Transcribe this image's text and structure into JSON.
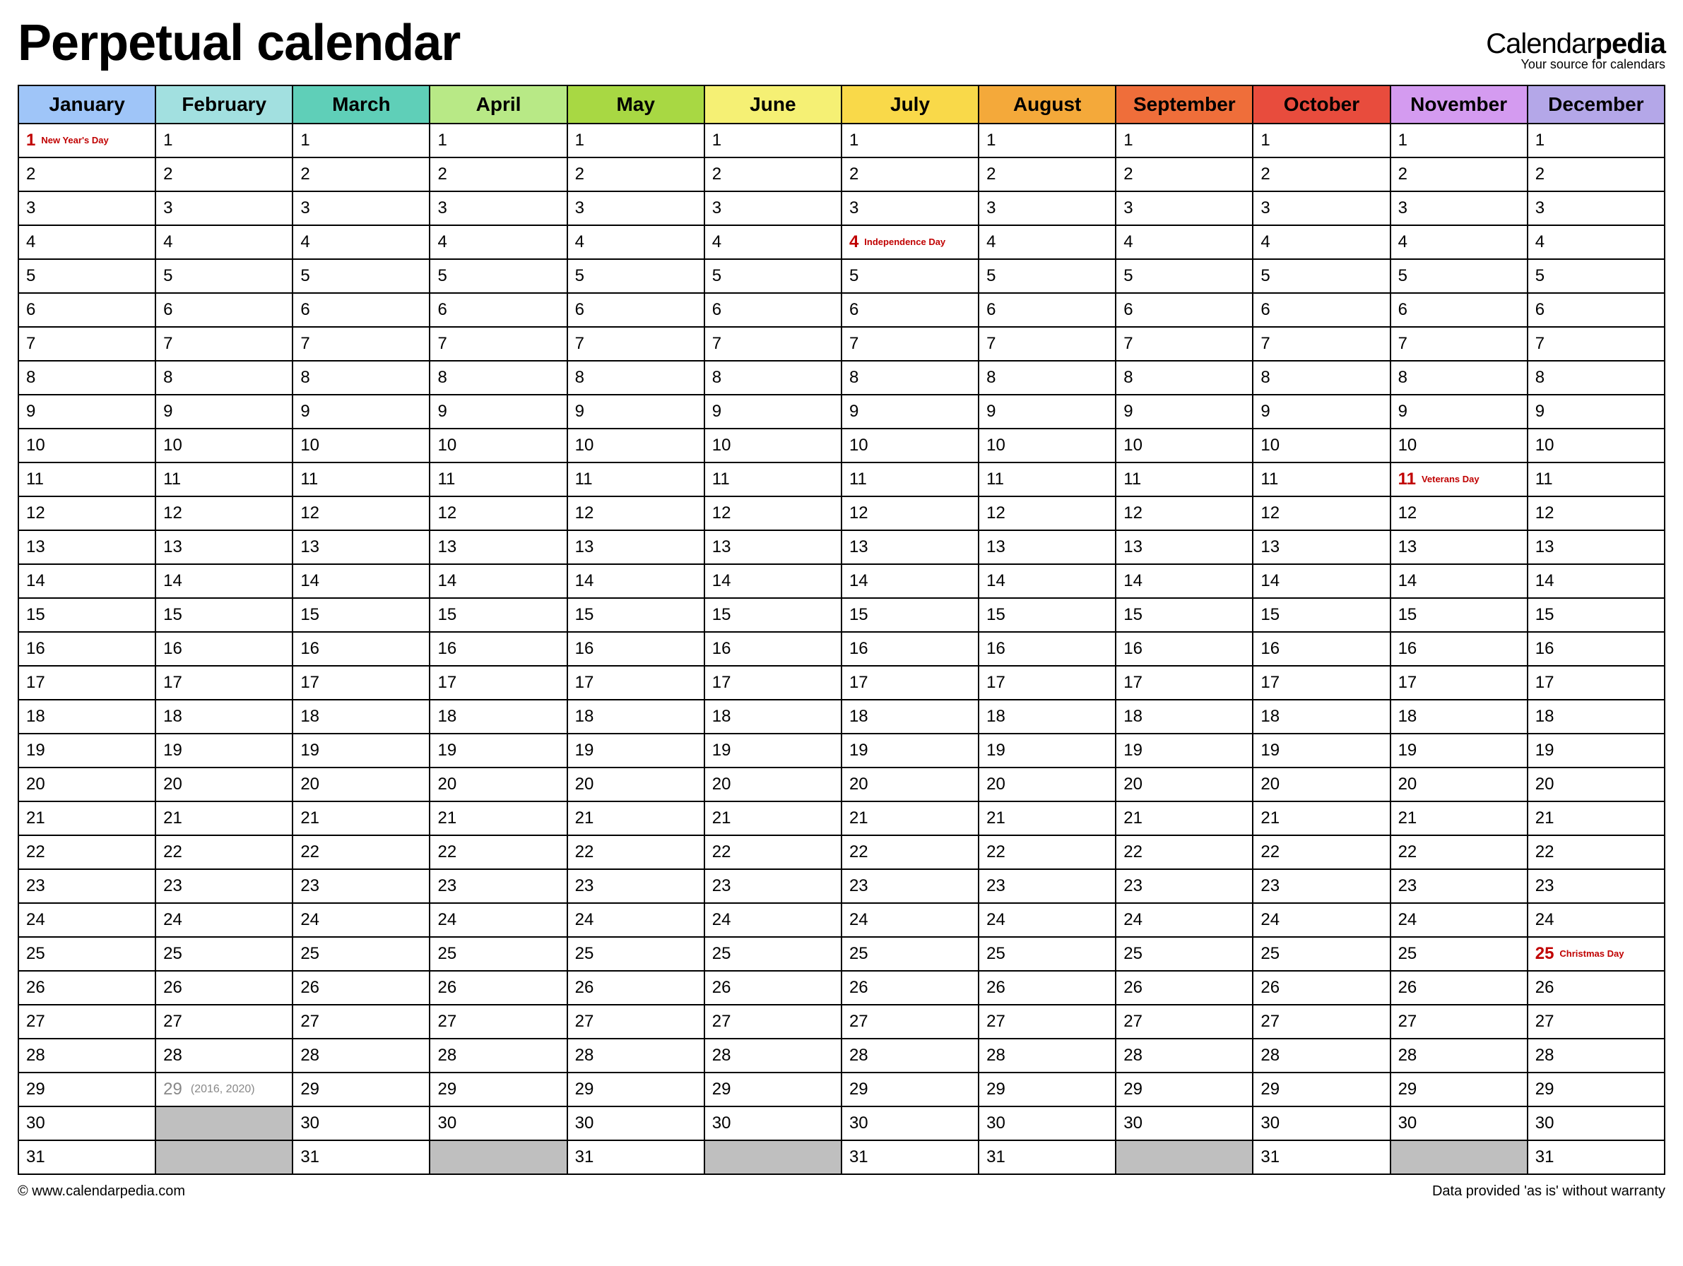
{
  "title": "Perpetual calendar",
  "logo": {
    "part1": "Calendar",
    "part2": "pedia",
    "tagline": "Your source for calendars"
  },
  "months": [
    {
      "name": "January",
      "color": "#9fc5f8",
      "days": 31
    },
    {
      "name": "February",
      "color": "#a2e0e0",
      "days": 29
    },
    {
      "name": "March",
      "color": "#5fcfb8",
      "days": 31
    },
    {
      "name": "April",
      "color": "#b8e986",
      "days": 30
    },
    {
      "name": "May",
      "color": "#a8d843",
      "days": 31
    },
    {
      "name": "June",
      "color": "#f5f074",
      "days": 30
    },
    {
      "name": "July",
      "color": "#f9d949",
      "days": 31
    },
    {
      "name": "August",
      "color": "#f4a93a",
      "days": 31
    },
    {
      "name": "September",
      "color": "#ef6e3a",
      "days": 30
    },
    {
      "name": "October",
      "color": "#e84c3d",
      "days": 31
    },
    {
      "name": "November",
      "color": "#d49bf0",
      "days": 30
    },
    {
      "name": "December",
      "color": "#b4a7e8",
      "days": 31
    }
  ],
  "max_days": 31,
  "holidays": {
    "0": {
      "1": "New Year's Day"
    },
    "6": {
      "4": "Independence Day"
    },
    "10": {
      "11": "Veterans Day"
    },
    "11": {
      "25": "Christmas Day"
    }
  },
  "feb29_note": "(2016, 2020)",
  "footer": {
    "left": "© www.calendarpedia.com",
    "right": "Data provided 'as is' without warranty"
  }
}
